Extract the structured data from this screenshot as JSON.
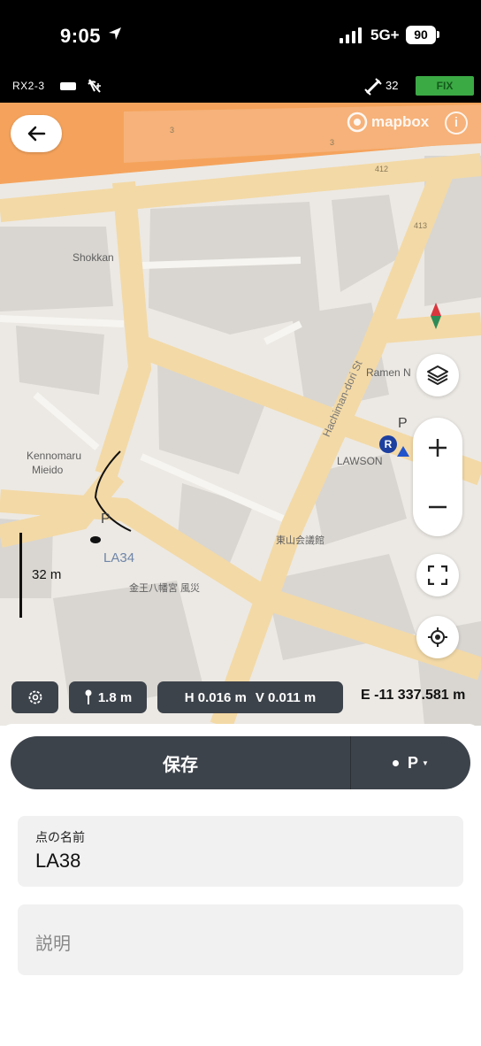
{
  "status_bar": {
    "time": "9:05",
    "network": "5G+",
    "battery": "90"
  },
  "device_bar": {
    "device_name": "RX2-3",
    "satellites": "32",
    "fix_status": "FIX"
  },
  "map": {
    "attribution": "mapbox",
    "labels": {
      "shokkan": "Shokkan",
      "kenomaru_1": "Kennomaru",
      "kenomaru_2": "Mieido",
      "ramen": "Ramen N",
      "lawson": "LAWSON",
      "street": "Hachiman-dori St",
      "jp_1": "東山会議館",
      "jp_2": "金王八幡宮 風災"
    },
    "road_numbers": [
      "3",
      "3",
      "412",
      "413"
    ],
    "poi_parking": "P",
    "poi_r": "R",
    "point_label": "LA34",
    "scale_label": "32 m"
  },
  "info_chips": {
    "antenna_height": "1.8 m",
    "h_accuracy": "H 0.016 m",
    "v_accuracy": "V 0.011 m",
    "easting": "E -11 337.581 m"
  },
  "sheet": {
    "save_label": "保存",
    "code_label": "P",
    "name_field": {
      "label": "点の名前",
      "value": "LA38"
    },
    "description_field": {
      "placeholder": "説明"
    }
  },
  "colors": {
    "accent_dark": "#3d434b",
    "fix_green": "#3ba944",
    "highway_orange": "#f5a35c"
  }
}
